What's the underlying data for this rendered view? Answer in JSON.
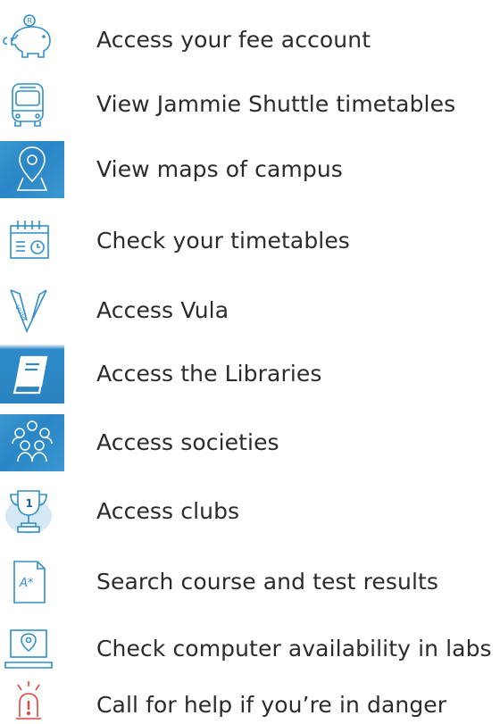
{
  "items": [
    {
      "label": "Access your fee account",
      "icon": "piggy-bank-icon"
    },
    {
      "label": "View Jammie Shuttle timetables",
      "icon": "bus-icon"
    },
    {
      "label": "View maps of campus",
      "icon": "map-pin-icon"
    },
    {
      "label": "Check your timetables",
      "icon": "calendar-clock-icon"
    },
    {
      "label": "Access Vula",
      "icon": "vula-logo-icon"
    },
    {
      "label": "Access the Libraries",
      "icon": "book-icon"
    },
    {
      "label": "Access societies",
      "icon": "people-group-icon"
    },
    {
      "label": "Access clubs",
      "icon": "trophy-icon"
    },
    {
      "label": "Search course and test results",
      "icon": "results-document-icon"
    },
    {
      "label": "Check computer availability in labs",
      "icon": "laptop-pin-icon"
    },
    {
      "label": "Call for help if you’re in danger",
      "icon": "alarm-light-icon"
    }
  ],
  "colors": {
    "icon_stroke": "#2f8fce",
    "tile_background": "#2e8bc9",
    "alert": "#e2453a",
    "text": "#2b2b2b"
  }
}
